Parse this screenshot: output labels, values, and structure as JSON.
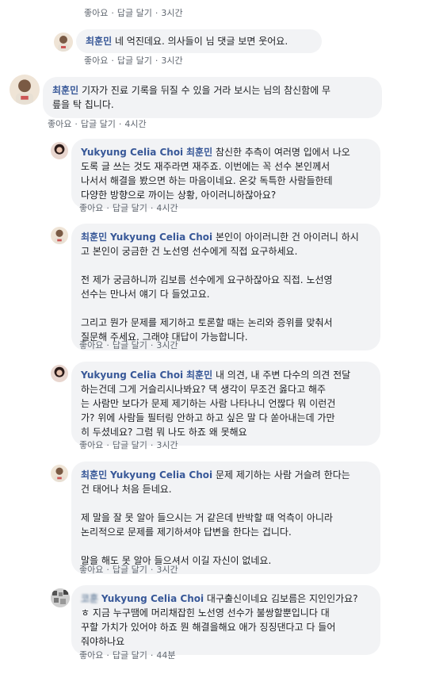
{
  "top": {
    "actions": {
      "like": "좋아요",
      "reply": "답글 달기",
      "time": "3시간"
    }
  },
  "c1": {
    "name": "최훈민",
    "text": "네 억진데요. 의사들이 님 댓글 보면 웃어요.",
    "actions": {
      "like": "좋아요",
      "reply": "답글 달기",
      "time": "3시간"
    }
  },
  "c2": {
    "name": "최훈민",
    "text1": "기자가 진료 기록을 뒤질 수 있을 거라 보시는 님의 참신함에 무",
    "text2": "릎을 탁 칩니다.",
    "actions": {
      "like": "좋아요",
      "reply": "답글 달기",
      "time": "4시간"
    }
  },
  "c3": {
    "name": "Yukyung Celia Choi",
    "tag": "최훈민",
    "l1": "참신한 추측이 여러명 입에서 나오",
    "l2": "도록 글 쓰는 것도 재주라면 재주죠. 이번에는 꼭 선수 본인께서",
    "l3": "나서서 해결을 봤으면 하는 마음이네요. 온갖 독특한 사람들한테",
    "l4": "다양한 방향으로 까이는 상황, 아이러니하잖아요?",
    "actions": {
      "like": "좋아요",
      "reply": "답글 달기",
      "time": "4시간"
    }
  },
  "c4": {
    "name": "최훈민",
    "tag": "Yukyung Celia Choi",
    "l1": "본인이 아이러니한 건 아이러니 하시",
    "l2": "고 본인이 궁금한 건 노선영 선수에게 직접 요구하세요.",
    "l3": "전 제가 궁금하니까 김보름 선수에게 요구하잖아요 직접. 노선영",
    "l4": "선수는 만나서 얘기 다 들었고요.",
    "l5": "그리고 뭔가 문제를 제기하고 토론할 때는 논리와 증위를 맞춰서",
    "l6": "질문해 주세요. 그래야 대답이 가능합니다.",
    "actions": {
      "like": "좋아요",
      "reply": "답글 달기",
      "time": "3시간"
    }
  },
  "c5": {
    "name": "Yukyung Celia Choi",
    "tag": "최훈민",
    "l1": "내 의견, 내 주변 다수의 의견 전달",
    "l2": "하는건데 그게 거슬리시나봐요? 댁 생각이 무조건 옳다고 해주",
    "l3": "는 사람만 보다가 문제 제기하는 사람 나타나니 언짢다 뭐 이런건",
    "l4": "가? 위에 사람들 필터링 안하고 하고 싶은 말 다 쏟아내는데 가만",
    "l5": "히 두셨네요? 그럼 뭐 나도 하죠 왜 못해요",
    "actions": {
      "like": "좋아요",
      "reply": "답글 달기",
      "time": "3시간"
    }
  },
  "c6": {
    "name": "최훈민",
    "tag": "Yukyung Celia Choi",
    "l1": "문제 제기하는 사람 거슬려 한다는",
    "l2": "건 태어나 처음 듣네요.",
    "l3": "제 말을 잘 못 알아 들으시는 거 같은데 반박할 때 억측이 아니라",
    "l4": "논리적으로 문제를 제기하셔야 답변을 한다는 겁니다.",
    "l5": "말을 해도 못 알아 들으셔서 이길 자신이 없네요.",
    "actions": {
      "like": "좋아요",
      "reply": "답글 달기",
      "time": "3시간"
    }
  },
  "c7": {
    "name": "코훈",
    "tag": "Yukyung Celia Choi",
    "l1": "대구출신이네요 김보름은 지인인가요?",
    "l2": "ㅎ 지금 누구땜에 머리채잡힌 노선영 선수가 불쌍할뿐입니다 대",
    "l3": "꾸할 가치가 있어야 하죠 뭔 해결을해요 애가 징징댄다고 다 들어",
    "l4": "줘야하나요",
    "actions": {
      "like": "좋아요",
      "reply": "답글 달기",
      "time": "44분"
    }
  },
  "colors": {
    "link": "#385898",
    "bubble": "#f2f3f5",
    "meta": "#606770"
  }
}
